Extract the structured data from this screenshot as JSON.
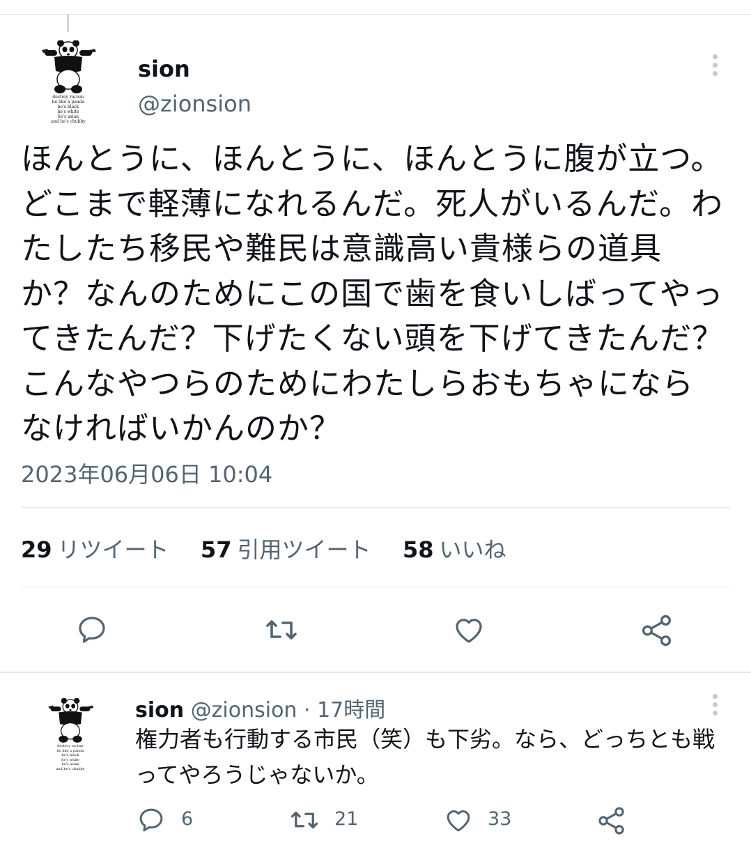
{
  "main_tweet": {
    "name": "sion",
    "handle": "@zionsion",
    "avatar_caption": [
      "destroy racism",
      "be like a panda",
      "he's black",
      "he's white",
      "he's asian",
      "and he's chubby"
    ],
    "text": "ほんとうに、ほんとうに、ほんとうに腹が立つ。どこまで軽薄になれるんだ。死人がいるんだ。わたしたち移民や難民は意識高い貴様らの道具か？なんのためにこの国で歯を食いしばってやってきたんだ？下げたくない頭を下げてきたんだ？こんなやつらのためにわたしらおもちゃにならなければいかんのか？",
    "timestamp": "2023年06月06日 10:04",
    "stats": {
      "retweets_count": "29",
      "retweets_label": "リツイート",
      "quotes_count": "57",
      "quotes_label": "引用ツイート",
      "likes_count": "58",
      "likes_label": "いいね"
    }
  },
  "reply_tweet": {
    "name": "sion",
    "handle": "@zionsion",
    "time": "· 17時間",
    "avatar_caption": [
      "destroy racism",
      "be like a panda",
      "he's black",
      "he's white",
      "he's asian",
      "and he's chubby"
    ],
    "text": "権力者も行動する市民（笑）も下劣。なら、どっちとも戦ってやろうじゃないか。",
    "replies": "6",
    "retweets": "21",
    "likes": "33"
  },
  "icons": [
    "reply-icon",
    "retweet-icon",
    "like-icon",
    "share-icon",
    "more-icon"
  ],
  "colors": {
    "text": "#0f1419",
    "secondary": "#536471",
    "divider": "#e4e7ea"
  }
}
